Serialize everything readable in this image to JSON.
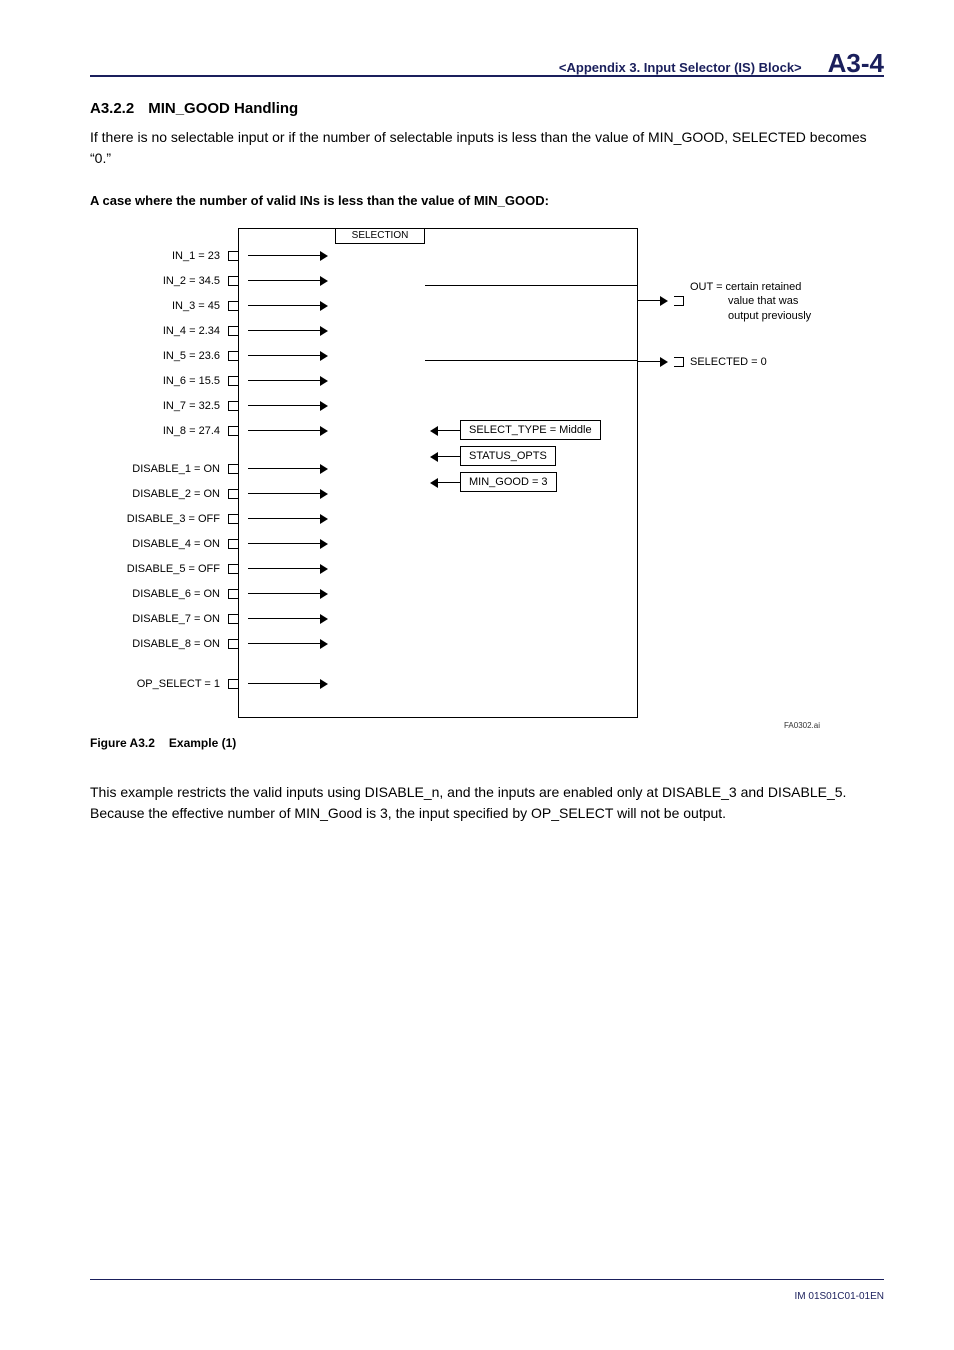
{
  "header": {
    "chapter": "<Appendix 3.  Input Selector (IS) Block>",
    "page": "A3-4"
  },
  "section": {
    "number": "A3.2.2",
    "title": "MIN_GOOD Handling"
  },
  "intro": "If there is no selectable input or if the number of selectable inputs is less than the value of MIN_GOOD, SELECTED becomes “0.”",
  "case_heading": "A case where the number of valid INs is less than the value of MIN_GOOD:",
  "diagram": {
    "selection_label": "SELECTION",
    "inputs": [
      "IN_1 = 23",
      "IN_2 = 34.5",
      "IN_3 = 45",
      "IN_4 = 2.34",
      "IN_5 = 23.6",
      "IN_6 = 15.5",
      "IN_7 = 32.5",
      "IN_8 = 27.4"
    ],
    "disables": [
      "DISABLE_1 = ON",
      "DISABLE_2 = ON",
      "DISABLE_3 = OFF",
      "DISABLE_4 = ON",
      "DISABLE_5 = OFF",
      "DISABLE_6 = ON",
      "DISABLE_7 = ON",
      "DISABLE_8 = ON"
    ],
    "op_select": "OP_SELECT = 1",
    "out_text_line1": "OUT = certain retained",
    "out_text_line2": "value that was",
    "out_text_line3": "output previously",
    "selected_text": "SELECTED = 0",
    "params": {
      "select_type": "SELECT_TYPE = Middle",
      "status_opts": "STATUS_OPTS",
      "min_good": "MIN_GOOD = 3"
    },
    "source_id": "FA0302.ai"
  },
  "figure": {
    "label": "Figure A3.2",
    "caption": "Example (1)"
  },
  "closing": "This example restricts the valid inputs using DISABLE_n, and the inputs are enabled only at DISABLE_3 and DISABLE_5. Because the effective number of MIN_Good is 3, the input specified by OP_SELECT will not be output.",
  "footer": "IM 01S01C01-01EN"
}
